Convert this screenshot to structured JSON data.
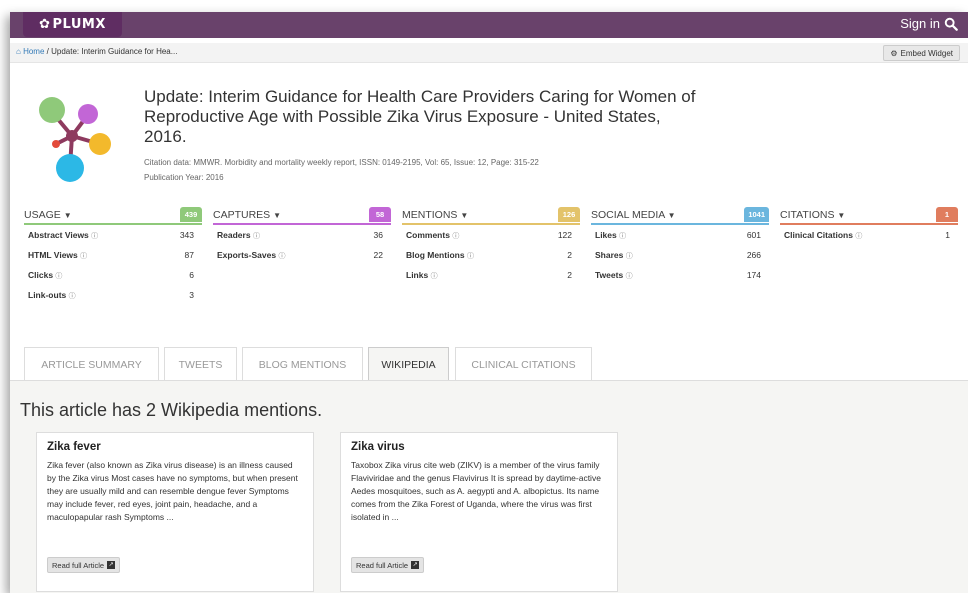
{
  "header": {
    "logo": "PLUMX",
    "signin_label": "Sign in"
  },
  "breadcrumb": {
    "home": "Home",
    "separator": "/",
    "current": "Update: Interim Guidance for Hea..."
  },
  "embed_label": "Embed Widget",
  "article": {
    "title": "Update: Interim Guidance for Health Care Providers Caring for Women of Reproductive Age with Possible Zika Virus Exposure - United States, 2016.",
    "citation": "Citation data: MMWR. Morbidity and mortality weekly report, ISSN: 0149-2195, Vol: 65, Issue: 12, Page: 315-22",
    "pub_year": "Publication Year: 2016"
  },
  "metrics": [
    {
      "title": "USAGE",
      "total": "439",
      "color": "#8fc97a",
      "rows": [
        {
          "label": "Abstract Views",
          "value": "343"
        },
        {
          "label": "HTML Views",
          "value": "87"
        },
        {
          "label": "Clicks",
          "value": "6"
        },
        {
          "label": "Link-outs",
          "value": "3"
        }
      ]
    },
    {
      "title": "CAPTURES",
      "total": "58",
      "color": "#c266d6",
      "rows": [
        {
          "label": "Readers",
          "value": "36"
        },
        {
          "label": "Exports-Saves",
          "value": "22"
        }
      ]
    },
    {
      "title": "MENTIONS",
      "total": "126",
      "color": "#e3c36a",
      "rows": [
        {
          "label": "Comments",
          "value": "122"
        },
        {
          "label": "Blog Mentions",
          "value": "2"
        },
        {
          "label": "Links",
          "value": "2"
        }
      ]
    },
    {
      "title": "SOCIAL MEDIA",
      "total": "1041",
      "color": "#6bb6de",
      "rows": [
        {
          "label": "Likes",
          "value": "601"
        },
        {
          "label": "Shares",
          "value": "266"
        },
        {
          "label": "Tweets",
          "value": "174"
        }
      ]
    },
    {
      "title": "CITATIONS",
      "total": "1",
      "color": "#e07d5e",
      "rows": [
        {
          "label": "Clinical Citations",
          "value": "1"
        }
      ]
    }
  ],
  "tabs": [
    {
      "label": "ARTICLE SUMMARY",
      "active": false
    },
    {
      "label": "TWEETS",
      "active": false
    },
    {
      "label": "BLOG MENTIONS",
      "active": false
    },
    {
      "label": "WIKIPEDIA",
      "active": true
    },
    {
      "label": "CLINICAL CITATIONS",
      "active": false
    }
  ],
  "wikipedia": {
    "heading": "This article has 2 Wikipedia mentions.",
    "cards": [
      {
        "title": "Zika fever",
        "text": "Zika fever (also known as Zika virus disease) is an illness caused by the Zika virus Most cases have no symptoms, but when present they are usually mild and can resemble dengue fever Symptoms may include fever, red eyes, joint pain, headache, and a maculopapular rash Symptoms ...",
        "button": "Read full Article"
      },
      {
        "title": "Zika virus",
        "text": "Taxobox Zika virus cite web (ZIKV) is a member of the virus family Flaviviridae and the genus Flavivirus It is spread by daytime-active Aedes mosquitoes, such as A. aegypti and A. albopictus. Its name comes from the Zika Forest of Uganda, where the virus was first isolated in ...",
        "button": "Read full Article"
      }
    ]
  },
  "icons": {
    "logo": "plum-icon",
    "signin": "search-icon",
    "home": "home-icon",
    "embed": "gear-icon",
    "info": "info-icon",
    "external": "external-link-icon"
  }
}
